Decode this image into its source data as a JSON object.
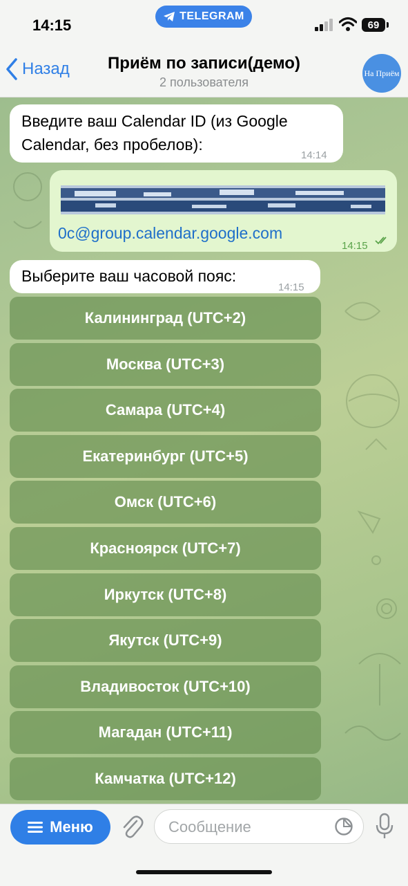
{
  "status_bar": {
    "time": "14:15",
    "pill_label": "TELEGRAM",
    "battery": "69"
  },
  "header": {
    "back_label": "Назад",
    "title": "Приём по записи(демо)",
    "subtitle": "2 пользователя",
    "avatar_text": "На Приём"
  },
  "messages": [
    {
      "direction": "in",
      "text_line1": "Введите ваш Calendar ID (из Google",
      "text_line2": "Calendar, без пробелов):",
      "time": "14:14"
    },
    {
      "direction": "out",
      "text": "0c@group.calendar.google.com",
      "time": "14:15",
      "redacted_prefix": true
    },
    {
      "direction": "in",
      "text": "Выберите ваш часовой пояс:",
      "time": "14:15"
    }
  ],
  "keyboard": [
    "Калининград (UTC+2)",
    "Москва (UTC+3)",
    "Самара (UTC+4)",
    "Екатеринбург (UTC+5)",
    "Омск (UTC+6)",
    "Красноярск (UTC+7)",
    "Иркутск (UTC+8)",
    "Якутск (UTC+9)",
    "Владивосток (UTC+10)",
    "Магадан (UTC+11)",
    "Камчатка (UTC+12)"
  ],
  "footer": {
    "menu_label": "Меню",
    "input_placeholder": "Сообщение",
    "input_value": ""
  },
  "colors": {
    "accent": "#2f7fe6",
    "outgoing_bubble": "#e3f6cf",
    "keyboard_button": "#6e9458"
  },
  "icons": [
    "telegram-plane-icon",
    "signal-icon",
    "wifi-icon",
    "back-chevron-icon",
    "read-checks-icon",
    "menu-lines-icon",
    "paperclip-icon",
    "sticker-icon",
    "microphone-icon"
  ]
}
